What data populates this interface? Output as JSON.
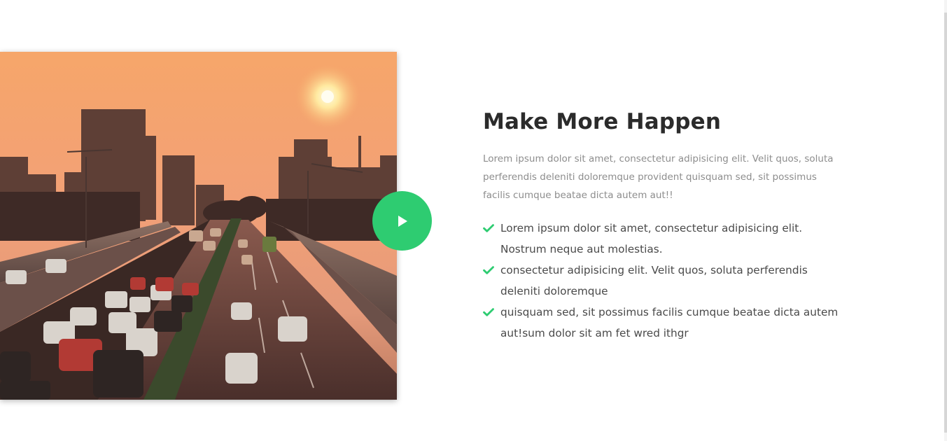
{
  "section": {
    "title": "Make More Happen",
    "intro": "Lorem ipsum dolor sit amet, consectetur adipisicing elit. Velit quos, soluta perferendis deleniti doloremque provident quisquam sed, sit possimus facilis cumque beatae dicta autem aut!!",
    "features": [
      "Lorem ipsum dolor sit amet, consectetur adipisicing elit. Nostrum neque aut molestias.",
      "consectetur adipisicing elit. Velit quos, soluta perferendis deleniti doloremque",
      "quisquam sed, sit possimus facilis cumque beatae dicta autem aut!sum dolor sit am fet wred ithgr"
    ]
  },
  "video": {
    "image": "city-highway-sunset-photo",
    "play_icon": "play-icon"
  },
  "colors": {
    "accent": "#2ecc71",
    "heading": "#2b2b2b",
    "body_text": "#8d8d8d",
    "list_text": "#4a4a4a"
  }
}
